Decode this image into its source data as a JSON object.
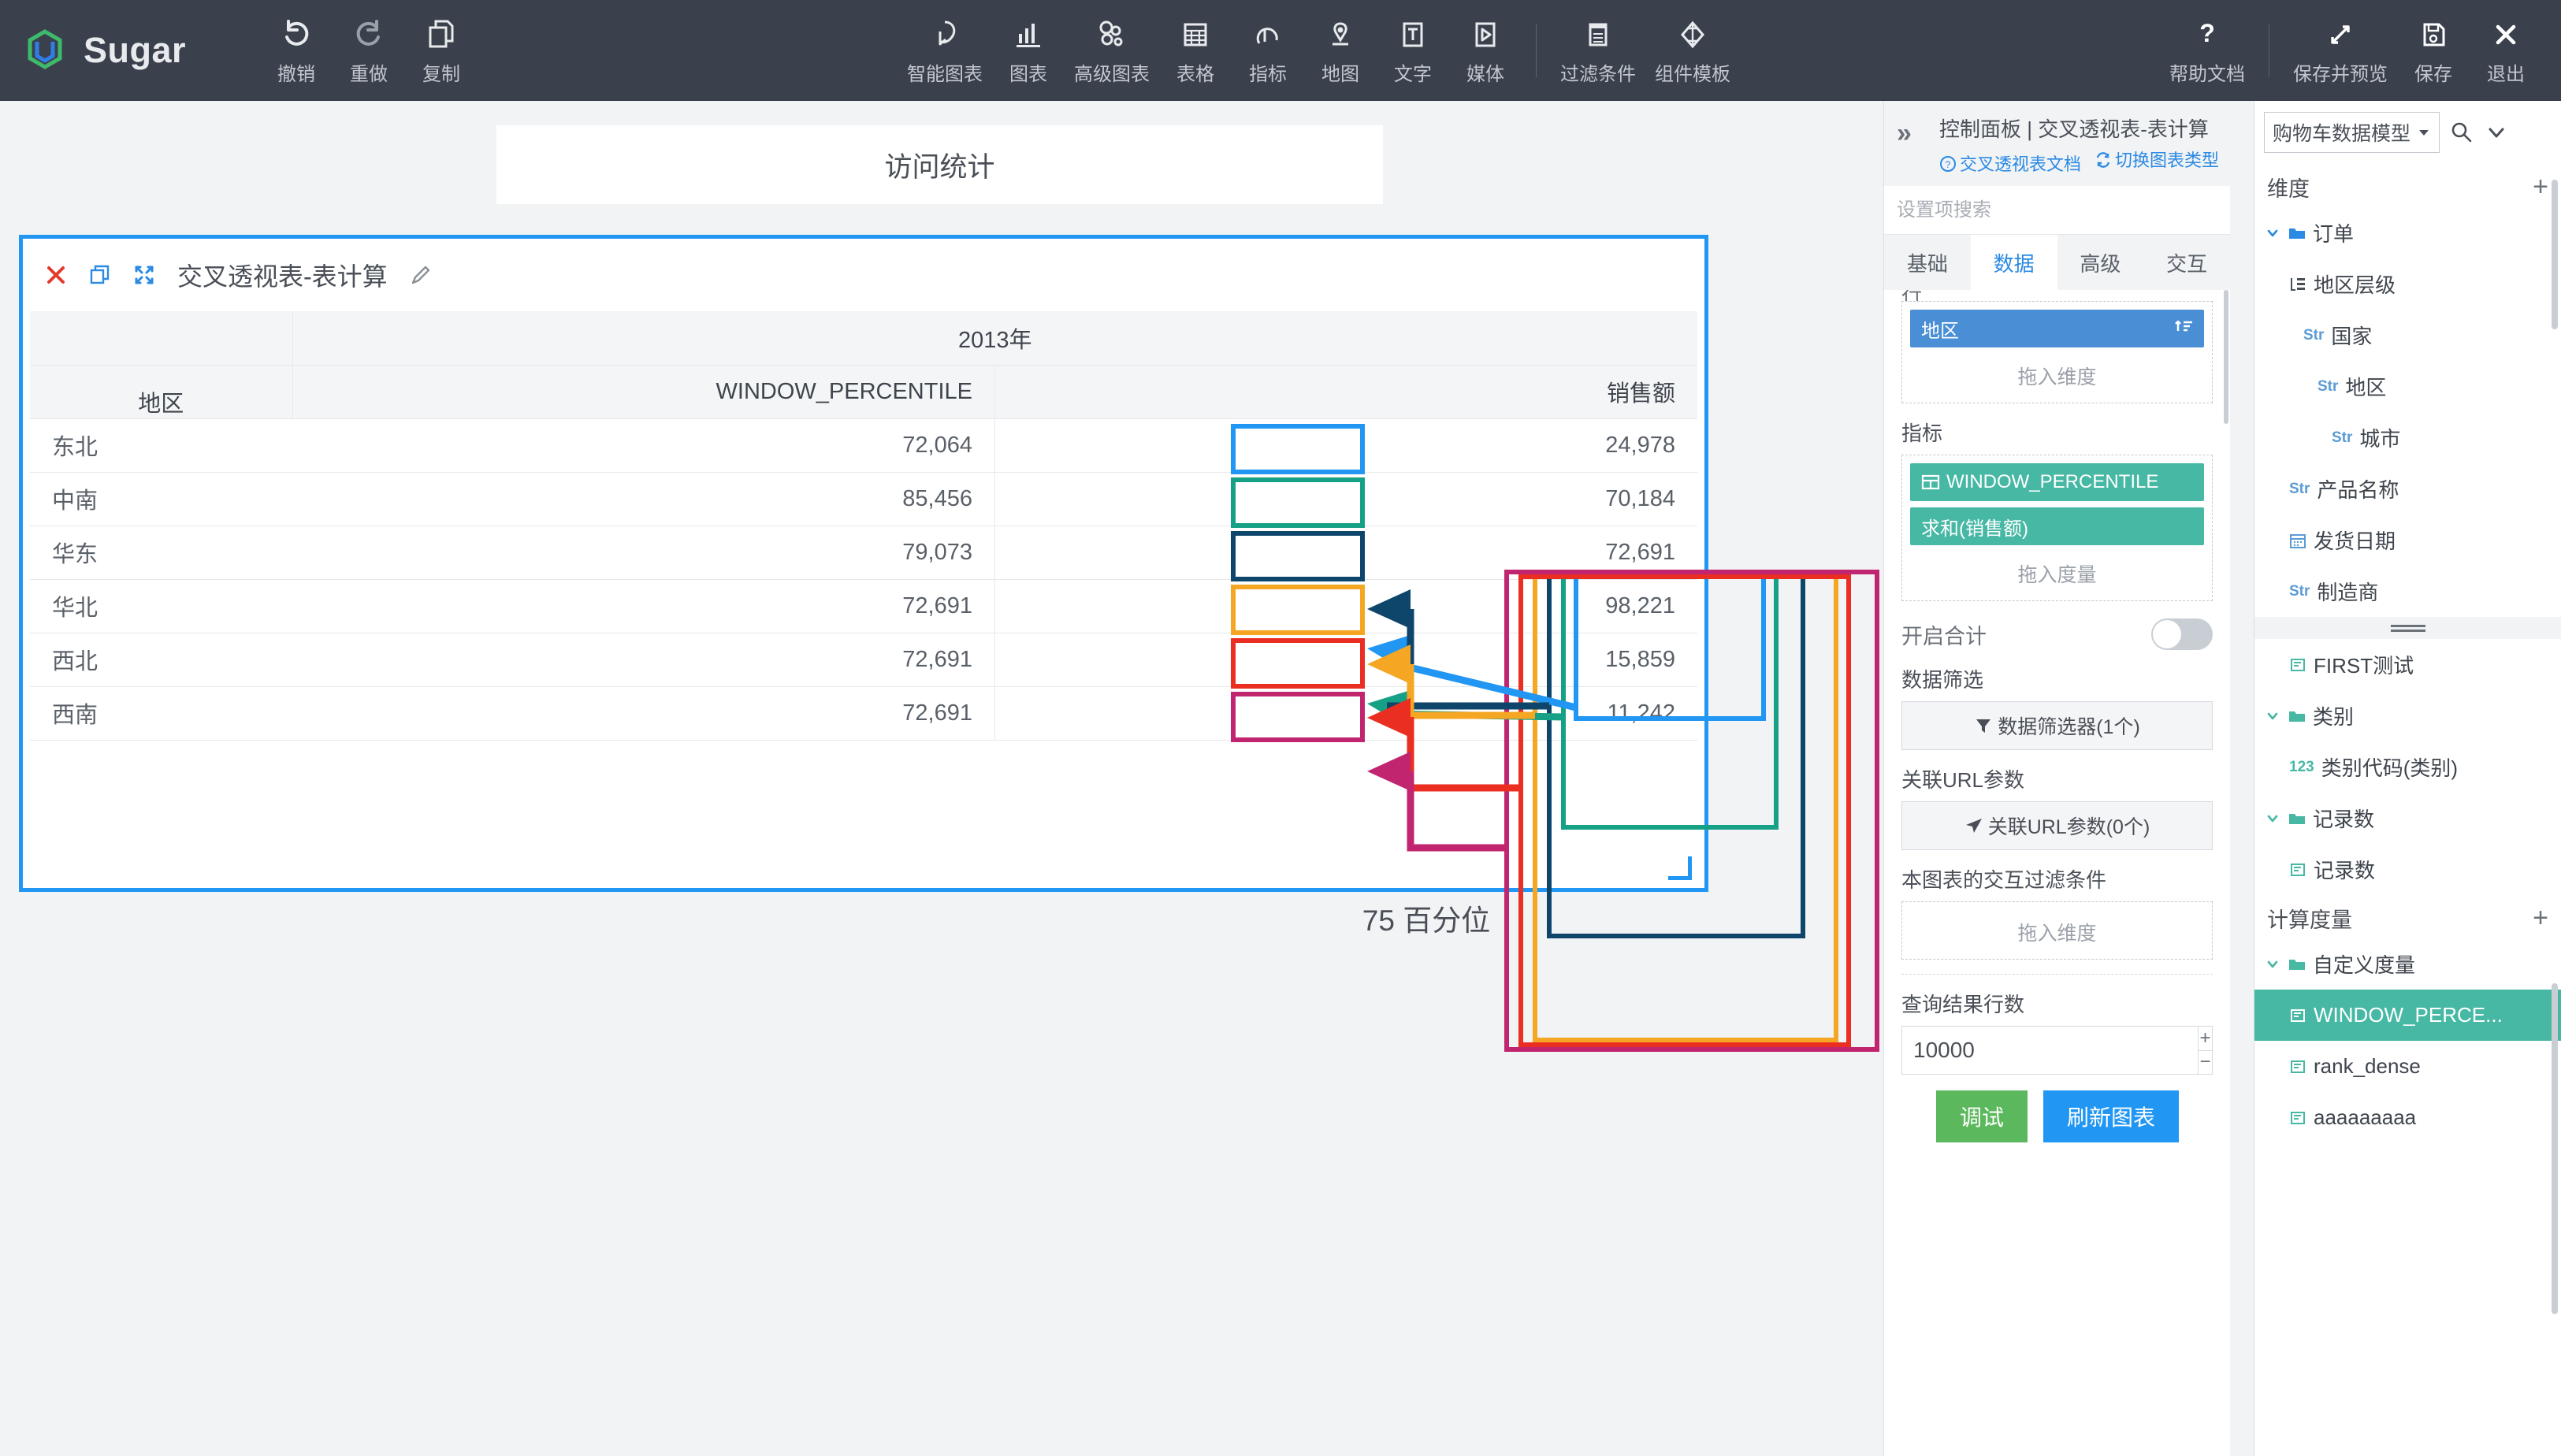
{
  "app": {
    "name": "Sugar"
  },
  "toolbar": {
    "left": [
      {
        "label": "撤销",
        "icon": "undo-icon"
      },
      {
        "label": "重做",
        "icon": "redo-icon"
      },
      {
        "label": "复制",
        "icon": "copy-icon"
      }
    ],
    "center": [
      {
        "label": "智能图表",
        "icon": "smart-chart-icon"
      },
      {
        "label": "图表",
        "icon": "bar-chart-icon"
      },
      {
        "label": "高级图表",
        "icon": "advanced-chart-icon"
      },
      {
        "label": "表格",
        "icon": "table-icon"
      },
      {
        "label": "指标",
        "icon": "metric-icon"
      },
      {
        "label": "地图",
        "icon": "map-icon"
      },
      {
        "label": "文字",
        "icon": "text-icon"
      },
      {
        "label": "媒体",
        "icon": "media-icon"
      }
    ],
    "center2": [
      {
        "label": "过滤条件",
        "icon": "filter-panel-icon"
      },
      {
        "label": "组件模板",
        "icon": "component-template-icon"
      }
    ],
    "right": [
      {
        "label": "帮助文档",
        "icon": "question-icon"
      }
    ],
    "right2": [
      {
        "label": "保存并预览",
        "icon": "expand-icon"
      },
      {
        "label": "保存",
        "icon": "save-icon"
      },
      {
        "label": "退出",
        "icon": "close-icon"
      }
    ]
  },
  "canvas": {
    "title_card": "访问统计",
    "chart_name": "交叉透视表-表计算",
    "percentile_note": "75 百分位"
  },
  "chart_data": {
    "type": "table",
    "title": "交叉透视表-表计算",
    "column_group_header": "2013年",
    "row_header": "地区",
    "columns": [
      "WINDOW_PERCENTILE",
      "销售额"
    ],
    "categories": [
      "东北",
      "中南",
      "华东",
      "华北",
      "西北",
      "西南"
    ],
    "series": [
      {
        "name": "WINDOW_PERCENTILE",
        "values": [
          "72,064",
          "85,456",
          "79,073",
          "72,691",
          "72,691",
          "72,691"
        ]
      },
      {
        "name": "销售额",
        "values": [
          "24,978",
          "70,184",
          "72,691",
          "98,221",
          "15,859",
          "11,242"
        ]
      }
    ],
    "annotation_note": "75 百分位",
    "annotation_colors": [
      "#2196f3",
      "#16a085",
      "#0e456b",
      "#f5a623",
      "#ea2e21",
      "#c2256f"
    ]
  },
  "config": {
    "breadcrumb": "控制面板 | 交叉透视表-表计算",
    "doc_link": "交叉透视表文档",
    "switch_chart": "切换图表类型",
    "search_placeholder": "设置项搜索",
    "tabs": [
      {
        "label": "基础",
        "active": false
      },
      {
        "label": "数据",
        "active": true
      },
      {
        "label": "高级",
        "active": false
      },
      {
        "label": "交互",
        "active": false
      }
    ],
    "cut_label": "行",
    "dimension_pill": "地区",
    "dimension_hint": "拖入维度",
    "metric_label": "指标",
    "metric_pills": [
      "WINDOW_PERCENTILE",
      "求和(销售额)"
    ],
    "metric_hint": "拖入度量",
    "total_label": "开启合计",
    "total_on": false,
    "filter_label": "数据筛选",
    "filter_button": "数据筛选器(1个)",
    "url_label": "关联URL参数",
    "url_button": "关联URL参数(0个)",
    "interact_label": "本图表的交互过滤条件",
    "interact_hint": "拖入维度",
    "rows_label": "查询结果行数",
    "rows_value": "10000",
    "debug_button": "调试",
    "refresh_button": "刷新图表"
  },
  "data_panel": {
    "model": "购物车数据模型",
    "dimension_section": "维度",
    "dimension_tree": [
      {
        "label": "订单",
        "kind": "folder",
        "indent": 0,
        "expanded": true
      },
      {
        "label": "地区层级",
        "kind": "hierarchy",
        "indent": 1
      },
      {
        "label": "国家",
        "kind": "str",
        "indent": 2
      },
      {
        "label": "地区",
        "kind": "str",
        "indent": 3
      },
      {
        "label": "城市",
        "kind": "str",
        "indent": 4
      },
      {
        "label": "产品名称",
        "kind": "str",
        "indent": 1
      },
      {
        "label": "发货日期",
        "kind": "date",
        "indent": 1
      },
      {
        "label": "制造商",
        "kind": "str",
        "indent": 1
      }
    ],
    "measure_tree": [
      {
        "label": "FIRST测试",
        "kind": "measure",
        "indent": 1
      },
      {
        "label": "类别",
        "kind": "folder-green",
        "indent": 0,
        "expanded": true
      },
      {
        "label": "类别代码(类别)",
        "kind": "num123",
        "indent": 1
      },
      {
        "label": "记录数",
        "kind": "folder-green",
        "indent": 0,
        "expanded": true
      },
      {
        "label": "记录数",
        "kind": "measure",
        "indent": 1
      }
    ],
    "calc_section": "计算度量",
    "calc_tree": [
      {
        "label": "自定义度量",
        "kind": "folder-green",
        "indent": 0,
        "expanded": true
      },
      {
        "label": "WINDOW_PERCE...",
        "kind": "measure",
        "indent": 1,
        "selected": true
      },
      {
        "label": "rank_dense",
        "kind": "measure",
        "indent": 1
      },
      {
        "label": "aaaaaaaaa",
        "kind": "measure",
        "indent": 1
      }
    ]
  }
}
